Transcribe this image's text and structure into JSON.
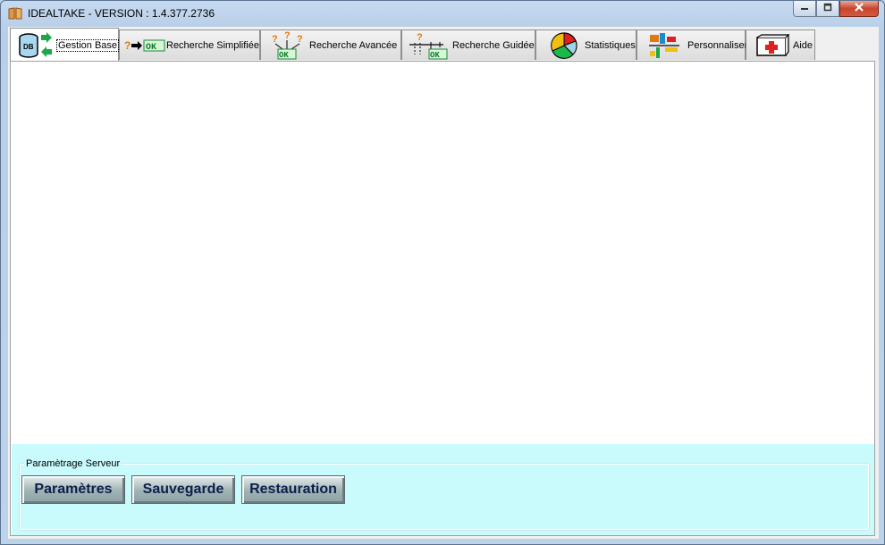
{
  "window": {
    "title": "IDEALTAKE - VERSION : 1.4.377.2736",
    "icon": "book-icon",
    "controls": {
      "minimize": "minimize-icon",
      "maximize": "maximize-icon",
      "close": "close-icon"
    }
  },
  "tabs": [
    {
      "id": "gestion-base",
      "label": "Gestion Base",
      "icon": "database-sync-icon",
      "active": true
    },
    {
      "id": "recherche-simplifiee",
      "label": "Recherche Simplifiée",
      "icon": "question-arrow-ok-icon",
      "active": false
    },
    {
      "id": "recherche-avancee",
      "label": "Recherche Avancée",
      "icon": "multi-question-ok-icon",
      "active": false
    },
    {
      "id": "recherche-guidee",
      "label": "Recherche Guidée",
      "icon": "guided-search-icon",
      "active": false
    },
    {
      "id": "statistiques",
      "label": "Statistiques",
      "icon": "pie-chart-icon",
      "active": false
    },
    {
      "id": "personnaliser",
      "label": "Personnaliser",
      "icon": "customize-icon",
      "active": false
    },
    {
      "id": "aide",
      "label": "Aide",
      "icon": "first-aid-icon",
      "active": false
    }
  ],
  "panel": {
    "group_label": "Paramètrage Serveur",
    "buttons": {
      "parametres": "Paramètres",
      "sauvegarde": "Sauvegarde",
      "restauration": "Restauration"
    }
  },
  "colors": {
    "bottom_pane_bg": "#c9fbfc",
    "button_text": "#0c1f4a",
    "close_button": "#c8452c"
  }
}
